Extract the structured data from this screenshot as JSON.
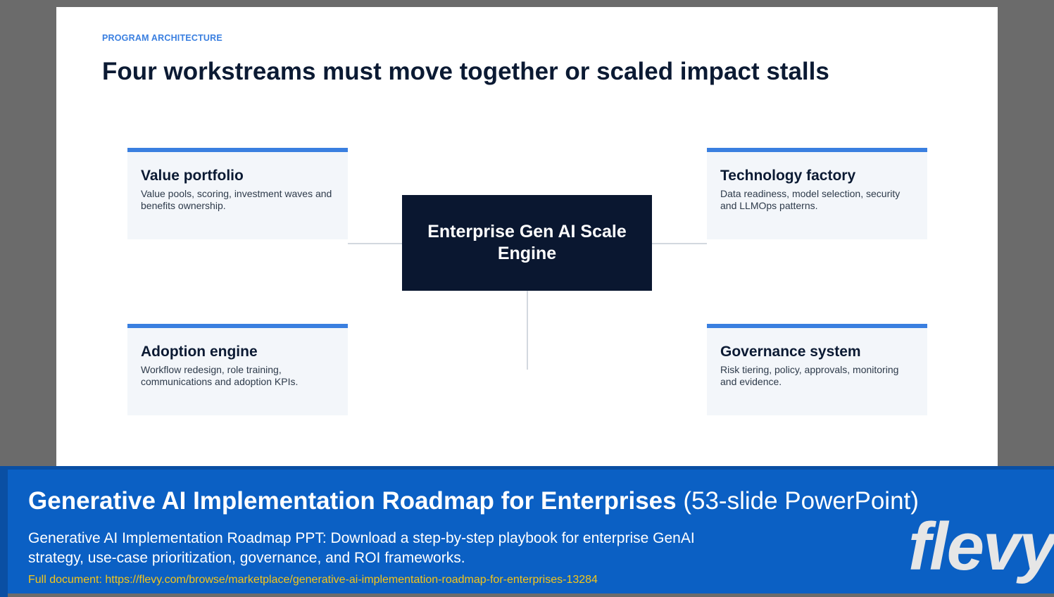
{
  "slide": {
    "eyebrow": "PROGRAM ARCHITECTURE",
    "title": "Four workstreams must move together or scaled impact stalls",
    "hub": "Enterprise Gen AI Scale Engine",
    "cards": [
      {
        "title": "Value portfolio",
        "desc": "Value pools, scoring, investment waves and benefits ownership."
      },
      {
        "title": "Technology factory",
        "desc": "Data readiness, model selection, security and LLMOps patterns."
      },
      {
        "title": "Adoption engine",
        "desc": "Workflow redesign, role training, communications and adoption KPIs."
      },
      {
        "title": "Governance system",
        "desc": "Risk tiering, policy, approvals, monitoring and evidence."
      }
    ],
    "colors": {
      "accent": "#3a7fe0",
      "hub_bg": "#0a1730",
      "card_bg": "#f3f6fa"
    }
  },
  "banner": {
    "title_bold": "Generative AI Implementation Roadmap for Enterprises",
    "title_light": "(53-slide PowerPoint)",
    "description": "Generative AI Implementation Roadmap PPT: Download a step-by-step playbook for enterprise GenAI strategy, use-case prioritization, governance, and ROI frameworks.",
    "link": "Full document: https://flevy.com/browse/marketplace/generative-ai-implementation-roadmap-for-enterprises-13284",
    "logo": "flevy",
    "colors": {
      "background": "#0b60c4",
      "link": "#f5c518"
    }
  }
}
